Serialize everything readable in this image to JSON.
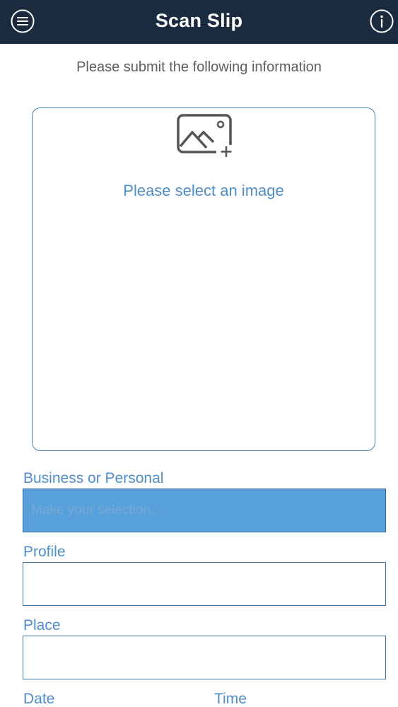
{
  "header": {
    "title": "Scan Slip",
    "menu_icon": "hamburger-menu-icon",
    "info_icon": "info-icon",
    "background_color": "#1b2b3f"
  },
  "subtitle": "Please submit the following information",
  "image_picker": {
    "icon": "add-image-icon",
    "label": "Please select an image"
  },
  "form": {
    "business_or_personal": {
      "label": "Business or Personal",
      "placeholder": "Make your selection..."
    },
    "profile": {
      "label": "Profile",
      "value": ""
    },
    "place": {
      "label": "Place",
      "value": ""
    },
    "date": {
      "label": "Date"
    },
    "time": {
      "label": "Time"
    }
  },
  "colors": {
    "accent": "#4f8ec9",
    "selection_fill": "#58a0dc",
    "border": "#3b6f9f"
  }
}
